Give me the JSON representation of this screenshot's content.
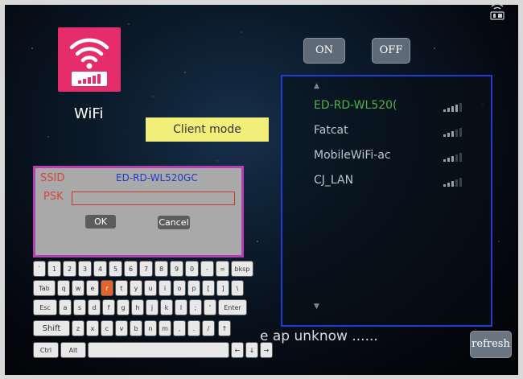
{
  "app": {
    "title": "WiFi"
  },
  "toggle": {
    "on_label": "ON",
    "off_label": "OFF"
  },
  "mode": {
    "label": "Client mode"
  },
  "ap_list": {
    "items": [
      {
        "ssid": "ED-RD-WL520(",
        "selected": true,
        "signal": 4
      },
      {
        "ssid": "Fatcat",
        "selected": false,
        "signal": 3
      },
      {
        "ssid": "MobileWiFi-ac",
        "selected": false,
        "signal": 3
      },
      {
        "ssid": "CJ_LAN",
        "selected": false,
        "signal": 3
      }
    ],
    "scroll_up_icon": "▲",
    "scroll_down_icon": "▼"
  },
  "dialog": {
    "ssid_label": "SSID",
    "ssid_value": "ED-RD-WL520GC",
    "psk_label": "PSK",
    "psk_value": "",
    "ok_label": "OK",
    "cancel_label": "Cancel"
  },
  "keyboard": {
    "active_key": "r",
    "keys": {
      "backtick": "`",
      "d1": "1",
      "d2": "2",
      "d3": "3",
      "d4": "4",
      "d5": "5",
      "d6": "6",
      "d7": "7",
      "d8": "8",
      "d9": "9",
      "d0": "0",
      "minus": "-",
      "equals": "=",
      "bksp": "bksp",
      "tab": "Tab",
      "q": "q",
      "w": "w",
      "e": "e",
      "r": "r",
      "t": "t",
      "y": "y",
      "u": "u",
      "i": "i",
      "o": "o",
      "p": "p",
      "lbracket": "[",
      "rbracket": "]",
      "backslash": "\\",
      "esc": "Esc",
      "a": "a",
      "s": "s",
      "d": "d",
      "f": "f",
      "g": "g",
      "h": "h",
      "j": "j",
      "k": "k",
      "l": "l",
      "semicolon": ";",
      "quote": "'",
      "enter": "Enter",
      "shift": "Shift",
      "z": "z",
      "x": "x",
      "c": "c",
      "v": "v",
      "b": "b",
      "n": "n",
      "m": "m",
      "comma": ",",
      "period": ".",
      "slash": "/",
      "up": "↑",
      "ctrl": "Ctrl",
      "alt": "Alt",
      "space": "",
      "left": "←",
      "down": "↓",
      "right": "→"
    }
  },
  "status": {
    "text": "e ap unknow ......"
  },
  "refresh": {
    "label": "refresh"
  },
  "colors": {
    "tile": "#e62d6b",
    "mode_badge": "#f2ee7a",
    "panel_border": "#1f3dd6",
    "dialog_border": "#b341b3",
    "selected_ap": "#49b34a",
    "error_label": "#d4473a",
    "active_key": "#e2662c"
  },
  "icons": {
    "wifi": "wifi-icon",
    "signal": "signal-bars-icon",
    "status": "battery-card-icon"
  }
}
